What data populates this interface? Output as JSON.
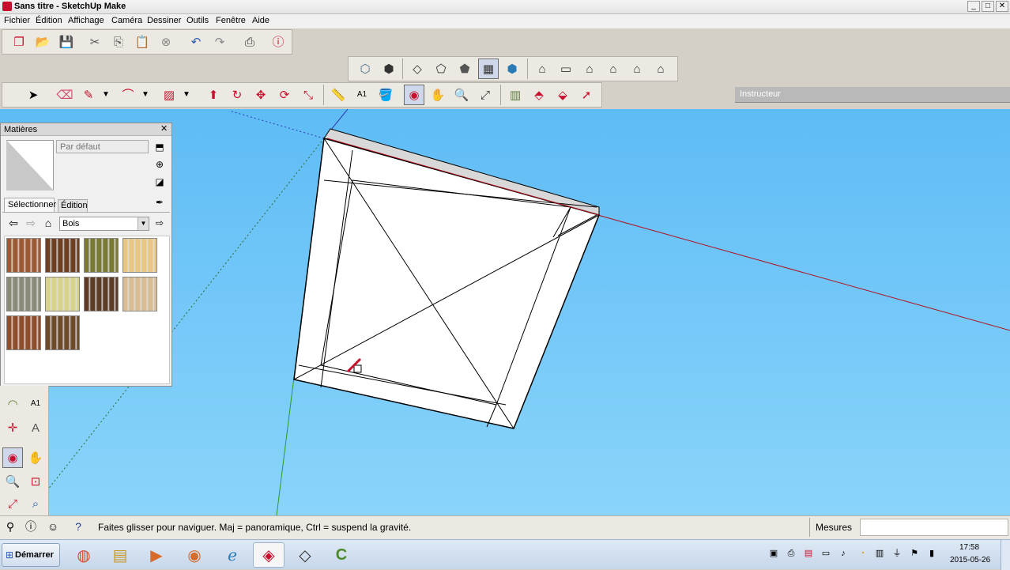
{
  "window": {
    "title": "Sans titre - SketchUp Make",
    "controls": {
      "minimize": "_",
      "maximize": "□",
      "close": "✕"
    }
  },
  "menu": [
    "Fichier",
    "Édition",
    "Affichage",
    "Caméra",
    "Dessiner",
    "Outils",
    "Fenêtre",
    "Aide"
  ],
  "instructor": {
    "title": "Instructeur"
  },
  "materials": {
    "title": "Matières",
    "name_placeholder": "Par défaut",
    "tab_select": "Sélectionner",
    "tab_edit": "Édition",
    "collection": "Bois",
    "swatches": [
      "#9b5a35",
      "#6e3f23",
      "#7a7a35",
      "#e9c684",
      "#8b8a78",
      "#d9d28a",
      "#5e3b25",
      "#d8bc94",
      "#8d4e2e",
      "#6d4a29"
    ]
  },
  "status": {
    "hint": "Faites glisser pour naviguer. Maj = panoramique, Ctrl =  suspend la gravité.",
    "measures_label": "Mesures",
    "measures_value": ""
  },
  "taskbar": {
    "start_label": "Démarrer",
    "clock_time": "17:58",
    "clock_date": "2015-05-26"
  }
}
